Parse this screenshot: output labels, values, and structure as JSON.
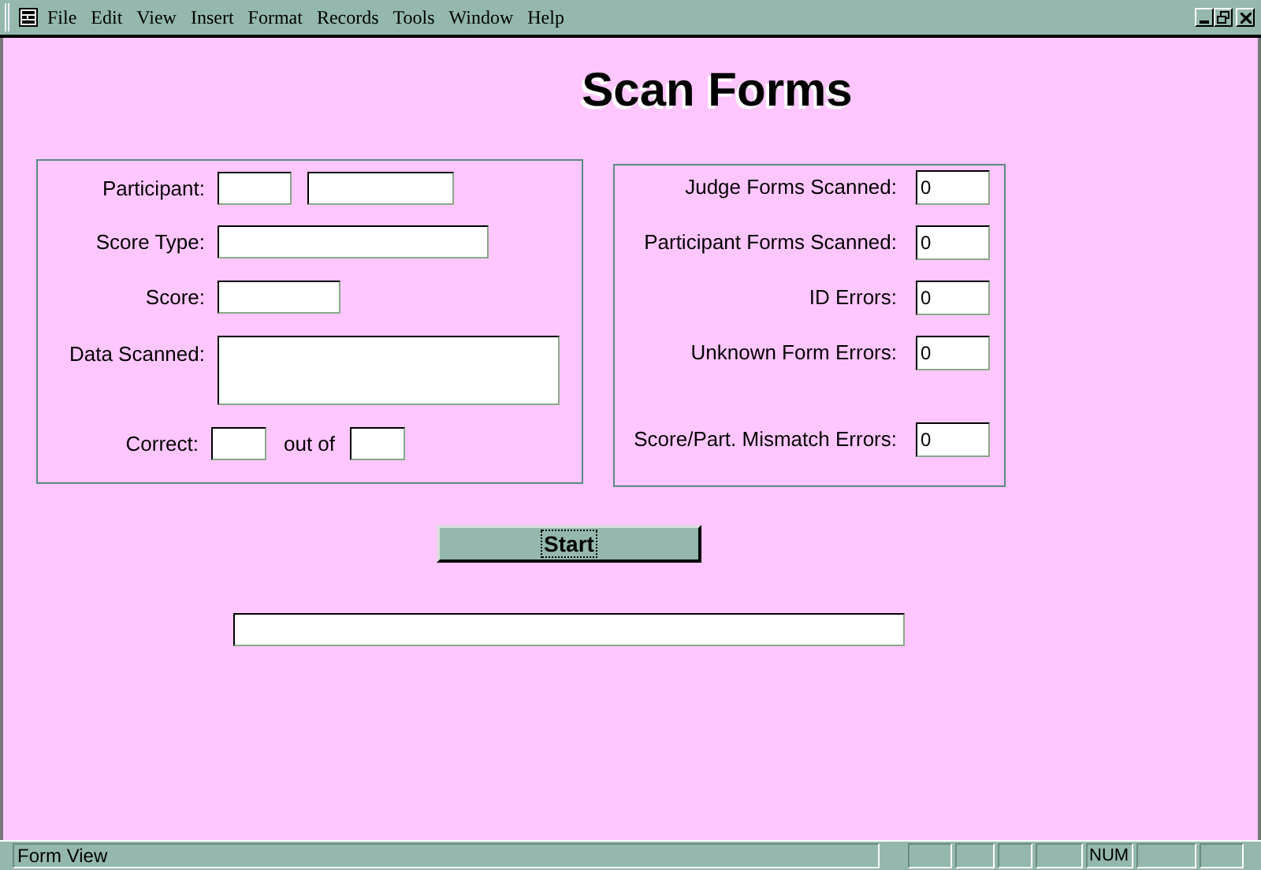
{
  "menu": [
    "File",
    "Edit",
    "View",
    "Insert",
    "Format",
    "Records",
    "Tools",
    "Window",
    "Help"
  ],
  "title": "Scan Forms",
  "entry_rows": [
    {
      "label": "Participant:",
      "kind": "pair"
    },
    {
      "label": "Score Type:",
      "kind": "text"
    },
    {
      "label": "Score:",
      "kind": "short"
    },
    {
      "label": "Data Scanned:",
      "kind": "memo"
    },
    {
      "label": "Correct:",
      "kind": "range",
      "between": "out of"
    }
  ],
  "counters": [
    {
      "label": "Judge Forms Scanned:",
      "value": "0"
    },
    {
      "label": "Participant Forms Scanned:",
      "value": "0"
    },
    {
      "label": "ID Errors:",
      "value": "0"
    },
    {
      "label": "Unknown Form Errors:",
      "value": "0"
    },
    {
      "label": "Score/Part. Mismatch Errors:",
      "value": "0"
    }
  ],
  "start_button": {
    "label": "Start",
    "focused": true
  },
  "status_bar": {
    "text": "Form View",
    "num_lock": "NUM"
  }
}
